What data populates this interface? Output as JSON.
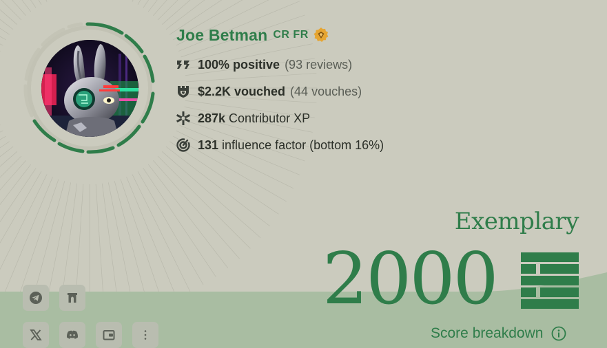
{
  "profile": {
    "name": "Joe Betman",
    "languages": "CR FR",
    "badge_icon": "verified-badge-icon"
  },
  "stats": [
    {
      "icon": "reviews-icon",
      "strong": "100% positive",
      "regular": "",
      "muted": "(93 reviews)"
    },
    {
      "icon": "vouch-shield-icon",
      "strong": "$2.2K vouched",
      "regular": "",
      "muted": "(44 vouches)"
    },
    {
      "icon": "contributor-xp-icon",
      "strong": "287k",
      "regular": "Contributor XP",
      "muted": ""
    },
    {
      "icon": "influence-icon",
      "strong": "131",
      "regular": "influence factor (bottom 16%)",
      "muted": ""
    }
  ],
  "score": {
    "level": "Exemplary",
    "value": "2000",
    "breakdown_label": "Score breakdown"
  },
  "social_links": [
    "telegram-icon",
    "farcaster-icon",
    "x-icon",
    "discord-icon",
    "wallet-icon",
    "more-icon"
  ],
  "colors": {
    "accent": "#2f7d4a",
    "background": "#cbcbbe",
    "wave": "#a9bda2",
    "badge": "#e6a532"
  }
}
